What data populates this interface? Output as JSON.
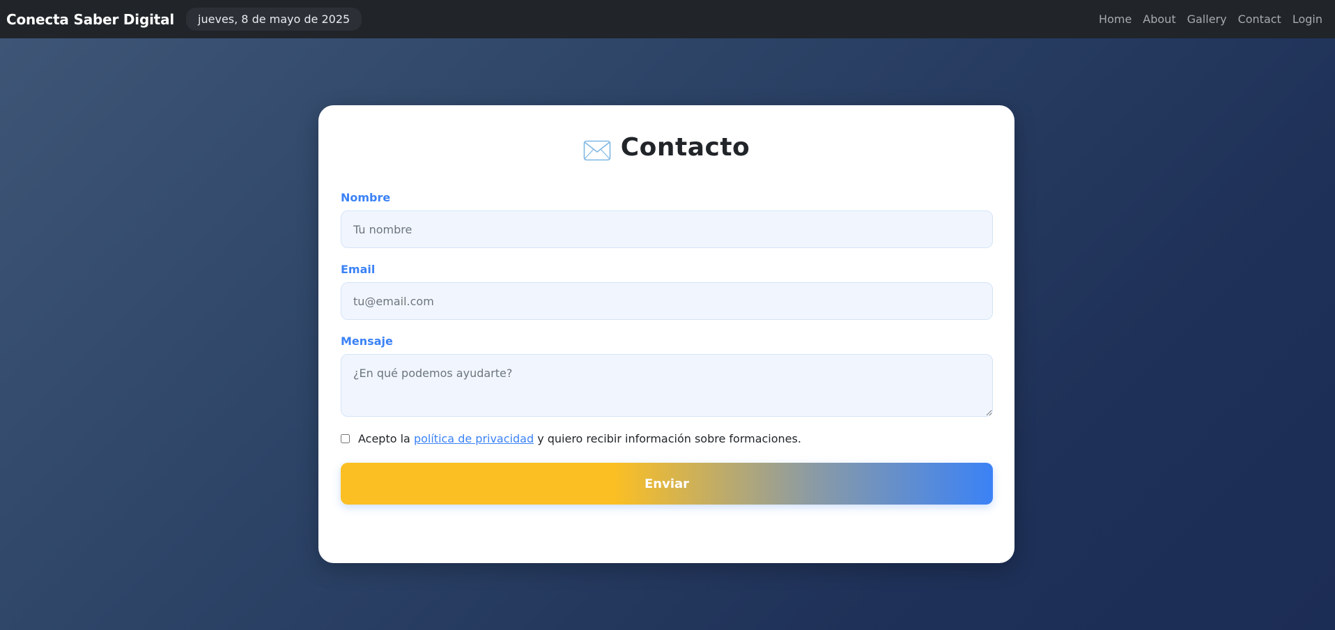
{
  "navbar": {
    "brand": "Conecta Saber Digital",
    "date": "jueves, 8 de mayo de 2025",
    "links": [
      "Home",
      "About",
      "Gallery",
      "Contact",
      "Login"
    ]
  },
  "contact": {
    "icon": "envelope-icon",
    "title": "Contacto",
    "name_label": "Nombre",
    "name_placeholder": "Tu nombre",
    "email_label": "Email",
    "email_placeholder": "tu@email.com",
    "message_label": "Mensaje",
    "message_placeholder": "¿En qué podemos ayudarte?",
    "consent_before": "Acepto la",
    "consent_link": "política de privacidad",
    "consent_after": "y quiero recibir información sobre formaciones.",
    "consent_checked": false,
    "submit_label": "Enviar"
  },
  "colors": {
    "navbar_bg": "#212529",
    "accent_blue": "#3b82f6",
    "accent_yellow": "#fbbf24"
  }
}
